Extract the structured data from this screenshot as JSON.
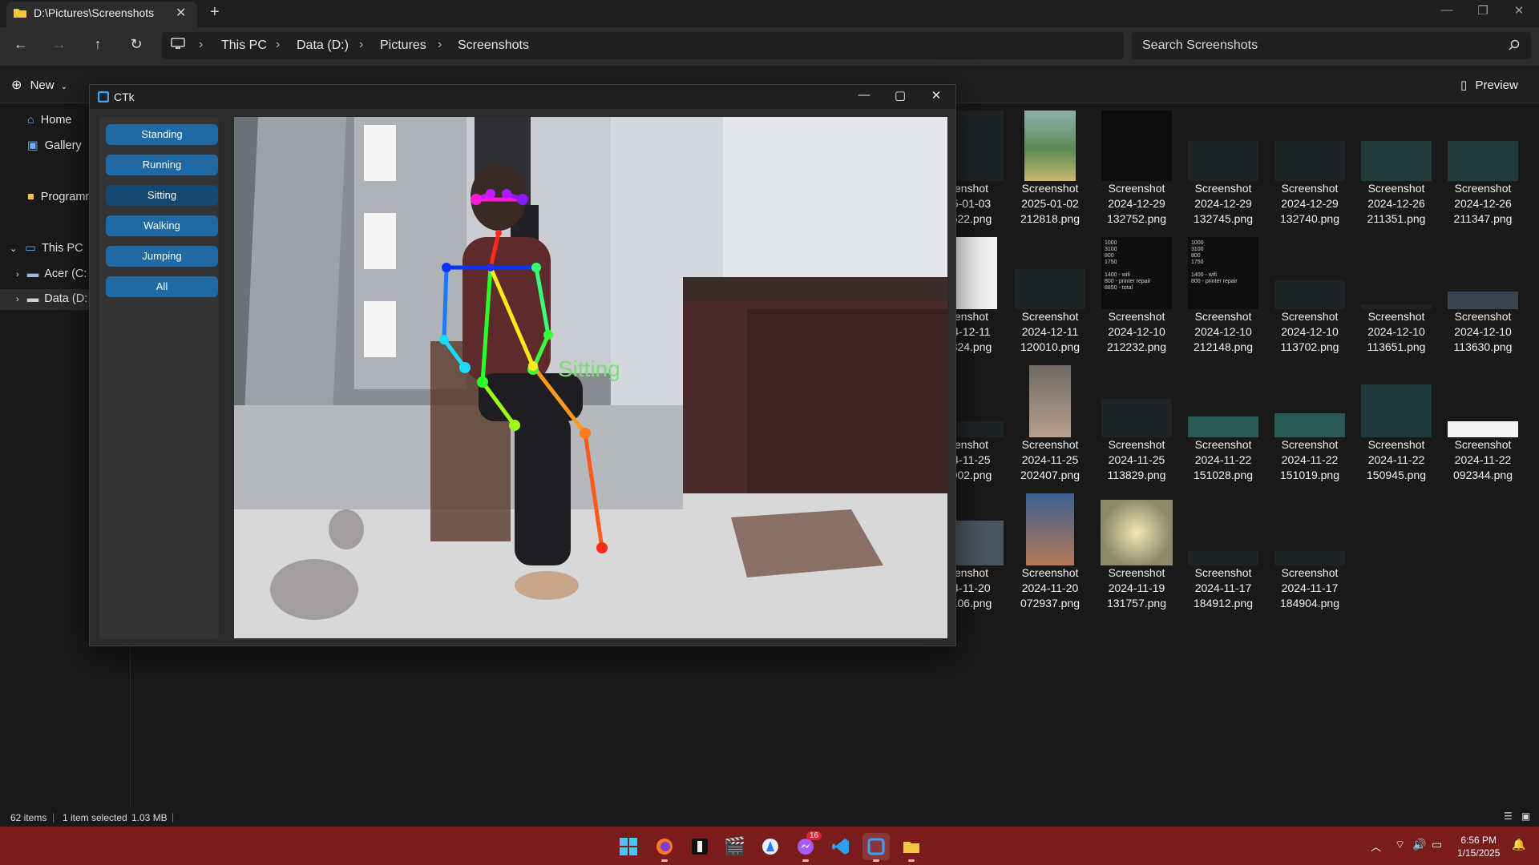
{
  "explorer": {
    "tab_title": "D:\\Pictures\\Screenshots",
    "breadcrumbs": [
      "This PC",
      "Data (D:)",
      "Pictures",
      "Screenshots"
    ],
    "search_placeholder": "Search Screenshots",
    "commands": {
      "new": "New",
      "preview": "Preview"
    },
    "nav": {
      "home": "Home",
      "gallery": "Gallery",
      "programs": "Programm",
      "this_pc": "This PC",
      "acer": "Acer (C:",
      "data": "Data (D:"
    },
    "files": [
      {
        "l1": "enshot",
        "l2": "5-01-03",
        "l3": "522.png"
      },
      {
        "l1": "Screenshot",
        "l2": "2025-01-02",
        "l3": "212818.png"
      },
      {
        "l1": "Screenshot",
        "l2": "2024-12-29",
        "l3": "132752.png"
      },
      {
        "l1": "Screenshot",
        "l2": "2024-12-29",
        "l3": "132745.png"
      },
      {
        "l1": "Screenshot",
        "l2": "2024-12-29",
        "l3": "132740.png"
      },
      {
        "l1": "Screenshot",
        "l2": "2024-12-26",
        "l3": "211351.png"
      },
      {
        "l1": "Screenshot",
        "l2": "2024-12-26",
        "l3": "211347.png"
      },
      {
        "l1": "enshot",
        "l2": "4-12-11",
        "l3": "324.png"
      },
      {
        "l1": "Screenshot",
        "l2": "2024-12-11",
        "l3": "120010.png"
      },
      {
        "l1": "Screenshot",
        "l2": "2024-12-10",
        "l3": "212232.png"
      },
      {
        "l1": "Screenshot",
        "l2": "2024-12-10",
        "l3": "212148.png"
      },
      {
        "l1": "Screenshot",
        "l2": "2024-12-10",
        "l3": "113702.png"
      },
      {
        "l1": "Screenshot",
        "l2": "2024-12-10",
        "l3": "113651.png"
      },
      {
        "l1": "Screenshot",
        "l2": "2024-12-10",
        "l3": "113630.png"
      },
      {
        "l1": "enshot",
        "l2": "4-11-25",
        "l3": "902.png"
      },
      {
        "l1": "Screenshot",
        "l2": "2024-11-25",
        "l3": "202407.png"
      },
      {
        "l1": "Screenshot",
        "l2": "2024-11-25",
        "l3": "113829.png"
      },
      {
        "l1": "Screenshot",
        "l2": "2024-11-22",
        "l3": "151028.png"
      },
      {
        "l1": "Screenshot",
        "l2": "2024-11-22",
        "l3": "151019.png"
      },
      {
        "l1": "Screenshot",
        "l2": "2024-11-22",
        "l3": "150945.png"
      },
      {
        "l1": "Screenshot",
        "l2": "2024-11-22",
        "l3": "092344.png"
      },
      {
        "l1": "enshot",
        "l2": "4-11-20",
        "l3": "106.png"
      },
      {
        "l1": "Screenshot",
        "l2": "2024-11-20",
        "l3": "072937.png"
      },
      {
        "l1": "Screenshot",
        "l2": "2024-11-19",
        "l3": "131757.png"
      },
      {
        "l1": "Screenshot",
        "l2": "2024-11-17",
        "l3": "184912.png"
      },
      {
        "l1": "Screenshot",
        "l2": "2024-11-17",
        "l3": "184904.png"
      }
    ],
    "thumb_notes": {
      "a": [
        "1000",
        "3100",
        "800",
        "1750",
        "",
        "1400 - wifi",
        "800 - printer repair",
        "8850 - total"
      ],
      "b": [
        "1000",
        "3100",
        "800",
        "1750",
        "",
        "1400 - wifi",
        "800 - printer repair"
      ]
    },
    "status": {
      "count": "62 items",
      "selection": "1 item selected",
      "size": "1.03 MB"
    }
  },
  "ctk": {
    "title": "CTk",
    "buttons": [
      "Standing",
      "Running",
      "Sitting",
      "Walking",
      "Jumping",
      "All"
    ],
    "selected": "Sitting",
    "overlay_label": "Sitting",
    "overlay_color": "#7ddc7a",
    "button_color": "#1f6aa5"
  },
  "taskbar": {
    "badge": "16",
    "time": "6:56 PM",
    "date": "1/15/2025",
    "color": "#7a1c1c"
  }
}
